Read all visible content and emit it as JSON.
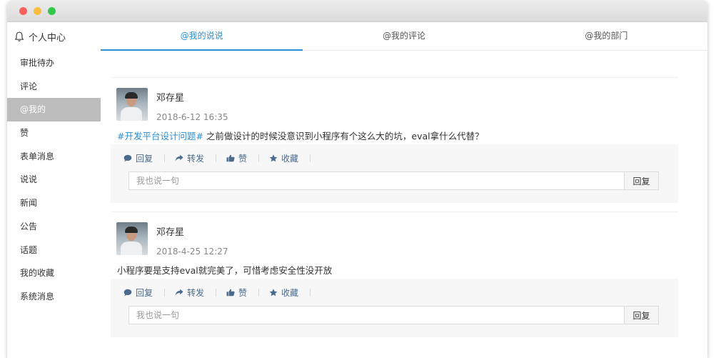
{
  "sidebar": {
    "header": "个人中心",
    "items": [
      {
        "label": "审批待办"
      },
      {
        "label": "评论"
      },
      {
        "label": "@我的"
      },
      {
        "label": "赞"
      },
      {
        "label": "表单消息"
      },
      {
        "label": "说说"
      },
      {
        "label": "新闻"
      },
      {
        "label": "公告"
      },
      {
        "label": "话题"
      },
      {
        "label": "我的收藏"
      },
      {
        "label": "系统消息"
      }
    ],
    "active_index": 2
  },
  "tabs": [
    {
      "label": "@我的说说"
    },
    {
      "label": "@我的评论"
    },
    {
      "label": "@我的部门"
    }
  ],
  "posts": [
    {
      "author": "邓存星",
      "time": "2018-6-12 16:35",
      "topic": "#开发平台设计问题#",
      "text": " 之前做设计的时候没意识到小程序有个这么大的坑，eval拿什么代替？",
      "actions": {
        "reply": "回复",
        "forward": "转发",
        "like": "赞",
        "favorite": "收藏"
      },
      "reply_placeholder": "我也说一句",
      "reply_button": "回复"
    },
    {
      "author": "邓存星",
      "time": "2018-4-25 12:27",
      "topic": "",
      "text": "小程序要是支持eval就完美了，可惜考虑安全性没开放",
      "actions": {
        "reply": "回复",
        "forward": "转发",
        "like": "赞",
        "favorite": "收藏"
      },
      "reply_placeholder": "我也说一句",
      "reply_button": "回复"
    }
  ],
  "colors": {
    "accent": "#2a8fd4",
    "sidebar_active": "#bcbcbc",
    "action_text": "#4a6b8f"
  },
  "icons": {
    "header": "bell-icon",
    "reply": "comment-icon",
    "forward": "share-icon",
    "like": "thumbs-up-icon",
    "favorite": "star-icon"
  }
}
